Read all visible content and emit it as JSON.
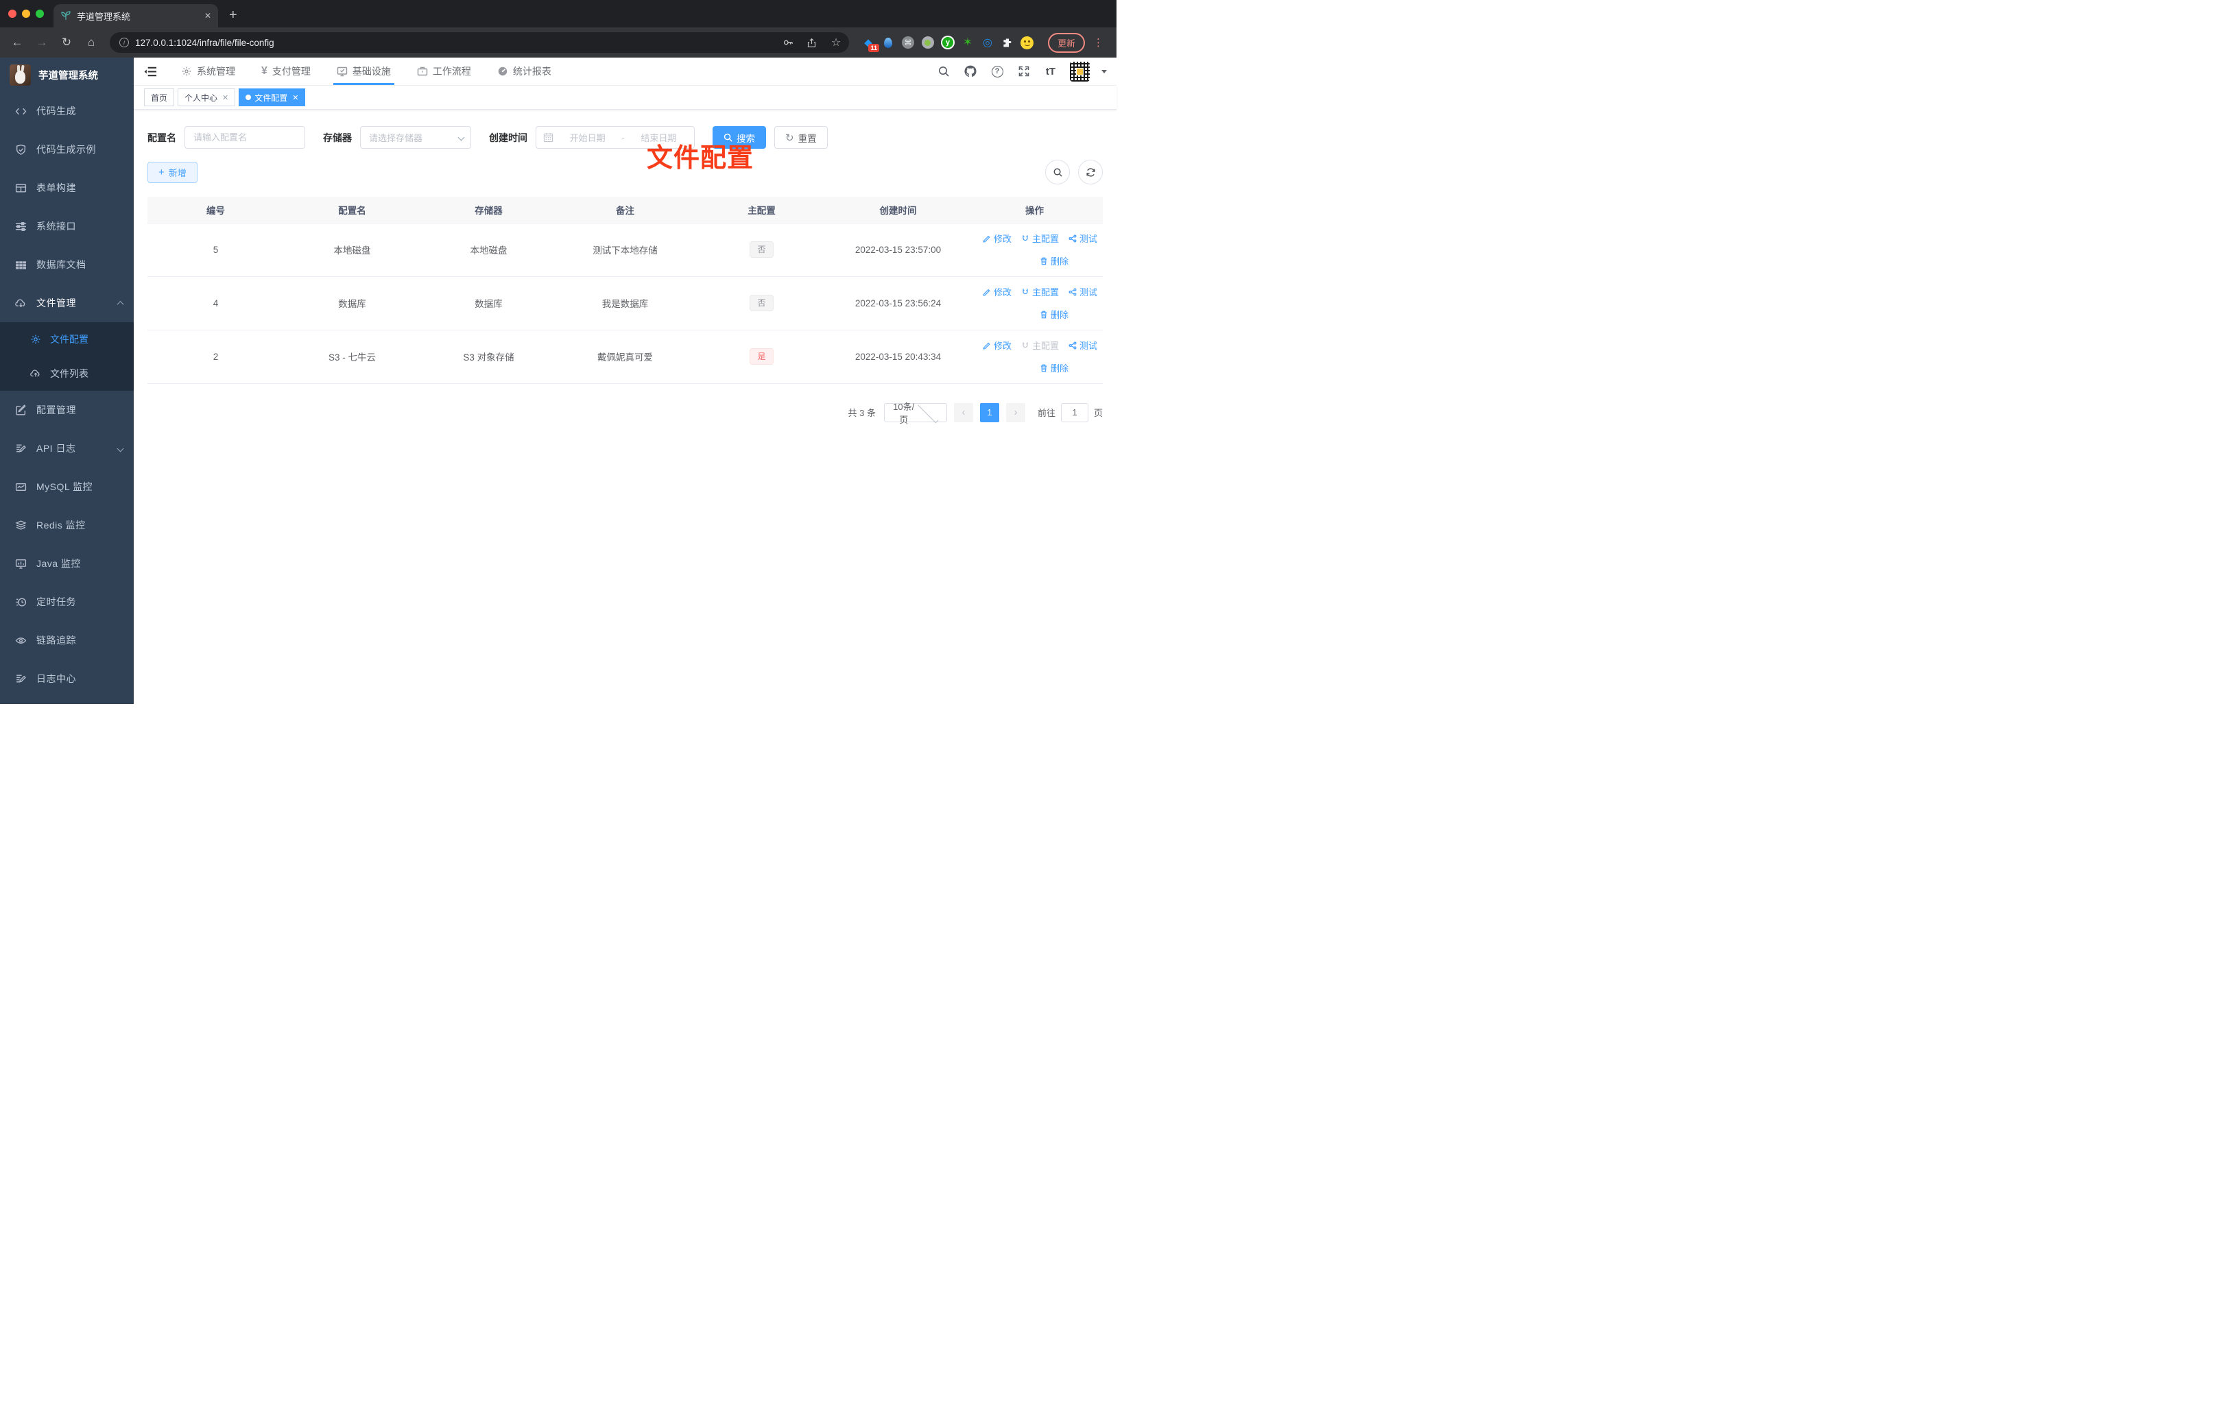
{
  "browser": {
    "tab_title": "芋道管理系统",
    "url": "127.0.0.1:1024/infra/file/file-config",
    "extension_badge": "11",
    "update_label": "更新"
  },
  "icons": {
    "close": "✕",
    "plus": "+",
    "back": "←",
    "forward": "→",
    "reload": "↻",
    "home": "⌂",
    "info_letter": "i",
    "star": "☆",
    "menu_dots": "⋮",
    "diamond": "◆",
    "command": "⌘",
    "letter_y": "y",
    "green_star": "✶",
    "eye_ext": "◎",
    "yuan": "¥",
    "question": "?",
    "font_size": "tT",
    "page_prev": "‹",
    "page_next": "›"
  },
  "sidebar": {
    "app_title": "芋道管理系统",
    "items": [
      {
        "label": "代码生成"
      },
      {
        "label": "代码生成示例"
      },
      {
        "label": "表单构建"
      },
      {
        "label": "系统接口"
      },
      {
        "label": "数据库文档"
      },
      {
        "label": "文件管理"
      },
      {
        "label": "文件配置"
      },
      {
        "label": "文件列表"
      },
      {
        "label": "配置管理"
      },
      {
        "label": "API 日志"
      },
      {
        "label": "MySQL 监控"
      },
      {
        "label": "Redis 监控"
      },
      {
        "label": "Java 监控"
      },
      {
        "label": "定时任务"
      },
      {
        "label": "链路追踪"
      },
      {
        "label": "日志中心"
      }
    ]
  },
  "topnav": {
    "items": [
      {
        "label": "系统管理"
      },
      {
        "label": "支付管理"
      },
      {
        "label": "基础设施"
      },
      {
        "label": "工作流程"
      },
      {
        "label": "统计报表"
      }
    ]
  },
  "tabsview": {
    "tabs": [
      {
        "label": "首页"
      },
      {
        "label": "个人中心"
      },
      {
        "label": "文件配置"
      }
    ]
  },
  "annotation": {
    "text": "文件配置"
  },
  "filter": {
    "name_label": "配置名",
    "name_placeholder": "请输入配置名",
    "storage_label": "存储器",
    "storage_placeholder": "请选择存储器",
    "date_label": "创建时间",
    "date_start_placeholder": "开始日期",
    "date_separator": "-",
    "date_end_placeholder": "结束日期",
    "search_label": "搜索",
    "reset_label": "重置"
  },
  "toolbar": {
    "add_label": "新增"
  },
  "table": {
    "columns": [
      "编号",
      "配置名",
      "存储器",
      "备注",
      "主配置",
      "创建时间",
      "操作"
    ],
    "actions": {
      "edit": "修改",
      "master": "主配置",
      "test": "测试",
      "delete": "删除"
    },
    "rows": [
      {
        "id": "5",
        "name": "本地磁盘",
        "storage": "本地磁盘",
        "remark": "测试下本地存储",
        "master": "否",
        "created": "2022-03-15 23:57:00"
      },
      {
        "id": "4",
        "name": "数据库",
        "storage": "数据库",
        "remark": "我是数据库",
        "master": "否",
        "created": "2022-03-15 23:56:24"
      },
      {
        "id": "2",
        "name": "S3 - 七牛云",
        "storage": "S3 对象存储",
        "remark": "戴佩妮真可爱",
        "master": "是",
        "created": "2022-03-15 20:43:34"
      }
    ]
  },
  "pagination": {
    "total": "共 3 条",
    "page_size": "10条/页",
    "current_page": "1",
    "goto_label": "前往",
    "goto_value": "1",
    "goto_suffix": "页"
  }
}
